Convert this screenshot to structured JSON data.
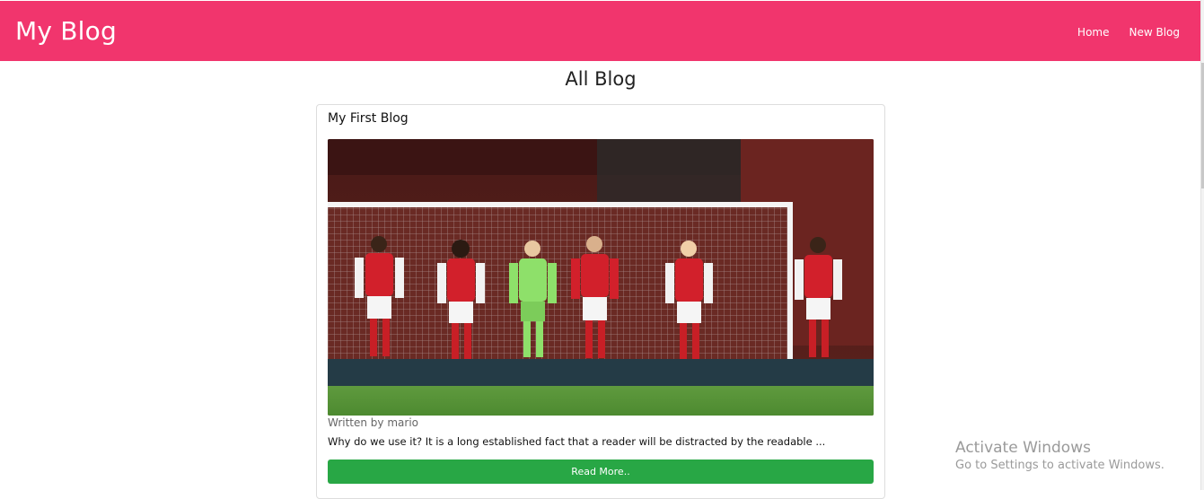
{
  "navbar": {
    "brand": "My Blog",
    "links": [
      {
        "label": "Home"
      },
      {
        "label": "New Blog"
      }
    ],
    "color": "#f1356d"
  },
  "main": {
    "title": "All Blog"
  },
  "blogs": [
    {
      "title": "My First Blog",
      "image_alt": "football-players-on-pitch-image",
      "author": "Written by mario",
      "snippet": "Why do we use it? It is a long established fact that a reader will be distracted by the readable ...",
      "button_label": "Read More..",
      "button_color": "#28a745"
    }
  ],
  "watermark": {
    "title": "Activate Windows",
    "subtitle": "Go to Settings to activate Windows."
  }
}
